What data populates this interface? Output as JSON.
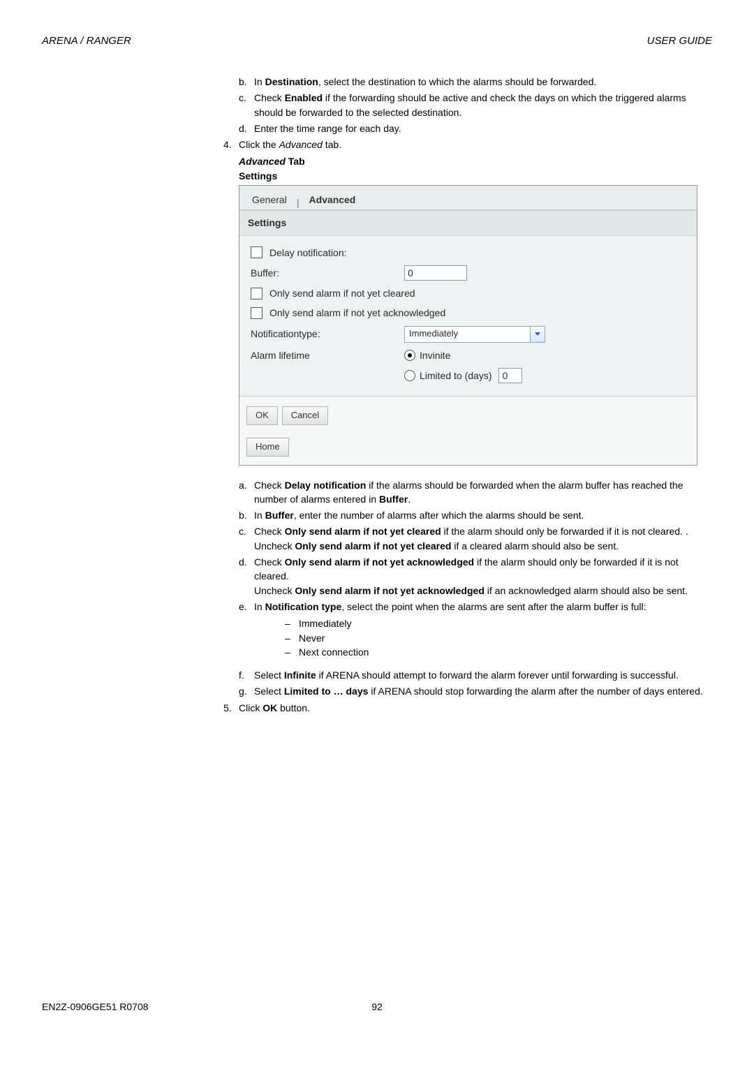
{
  "header": {
    "left": "ARENA / RANGER",
    "right": "USER GUIDE"
  },
  "intro": {
    "b_marker": "b.",
    "b_text_1": "In ",
    "b_bold": "Destination",
    "b_text_2": ", select the destination to which the alarms should be forwarded.",
    "c_marker": "c.",
    "c_text_1": "Check ",
    "c_bold": "Enabled",
    "c_text_2": " if the forwarding should be active and check the days on which the triggered alarms should be forwarded to the selected destination.",
    "d_marker": "d.",
    "d_text": "Enter the time range for each day.",
    "step4_marker": "4.",
    "step4_text_1": "Click the ",
    "step4_italic": "Advanced",
    "step4_text_2": " tab.",
    "heading_italic": "Advanced",
    "heading_bold": " Tab",
    "settings_bold": "Settings"
  },
  "ui": {
    "tabs": {
      "general": "General",
      "sep": "|",
      "advanced": "Advanced"
    },
    "settings_header": "Settings",
    "delay_label": "Delay notification:",
    "buffer_label": "Buffer:",
    "buffer_value": "0",
    "not_cleared_label": "Only send alarm if not yet cleared",
    "not_ack_label": "Only send alarm if not yet acknowledged",
    "notif_type_label": "Notificationtype:",
    "notif_type_value": "Immediately",
    "alarm_lifetime_label": "Alarm lifetime",
    "radio_infinite": "Invinite",
    "radio_limited": "Limited to (days)",
    "limited_value": "0",
    "ok_btn": "OK",
    "cancel_btn": "Cancel",
    "home_btn": "Home"
  },
  "after": {
    "a_marker": "a.",
    "a_1": "Check ",
    "a_b1": "Delay notification",
    "a_2": " if the alarms should be forwarded when the alarm buffer has reached the number of alarms entered in ",
    "a_b2": "Buffer",
    "a_3": ".",
    "b_marker": "b.",
    "b_1": "In ",
    "b_b1": "Buffer",
    "b_2": ", enter the number of alarms after which the alarms should be sent.",
    "c_marker": "c.",
    "c_1": "Check ",
    "c_b1": "Only send alarm if not yet cleared",
    "c_2": " if the alarm should only be forwarded if it is not cleared. .",
    "c_3": "Uncheck ",
    "c_b2": "Only send alarm if not yet cleared",
    "c_4": " if a cleared alarm should also be sent.",
    "d_marker": "d.",
    "d_1": "Check ",
    "d_b1": "Only send alarm if not yet acknowledged",
    "d_2": " if the alarm should only be forwarded if it is not cleared.",
    "d_3": "Uncheck ",
    "d_b2": "Only send alarm if not yet acknowledged",
    "d_4": " if an acknowledged alarm should also be sent.",
    "e_marker": "e.",
    "e_1": "In ",
    "e_b1": "Notification type",
    "e_2": ", select the point when the alarms are sent after the alarm buffer is full:",
    "e_dash1": "Immediately",
    "e_dash2": "Never",
    "e_dash3": "Next connection",
    "f_marker": "f.",
    "f_1": "Select ",
    "f_b1": "Infinite",
    "f_2": " if ARENA should attempt to forward the alarm forever until forwarding is successful.",
    "g_marker": "g.",
    "g_1": "Select ",
    "g_b1": "Limited to … days",
    "g_2": " if ARENA should stop forwarding the alarm after the number of days entered.",
    "step5_marker": "5.",
    "step5_1": "Click ",
    "step5_b": "OK",
    "step5_2": " button."
  },
  "footer": {
    "left": "EN2Z-0906GE51 R0708",
    "page": "92"
  }
}
